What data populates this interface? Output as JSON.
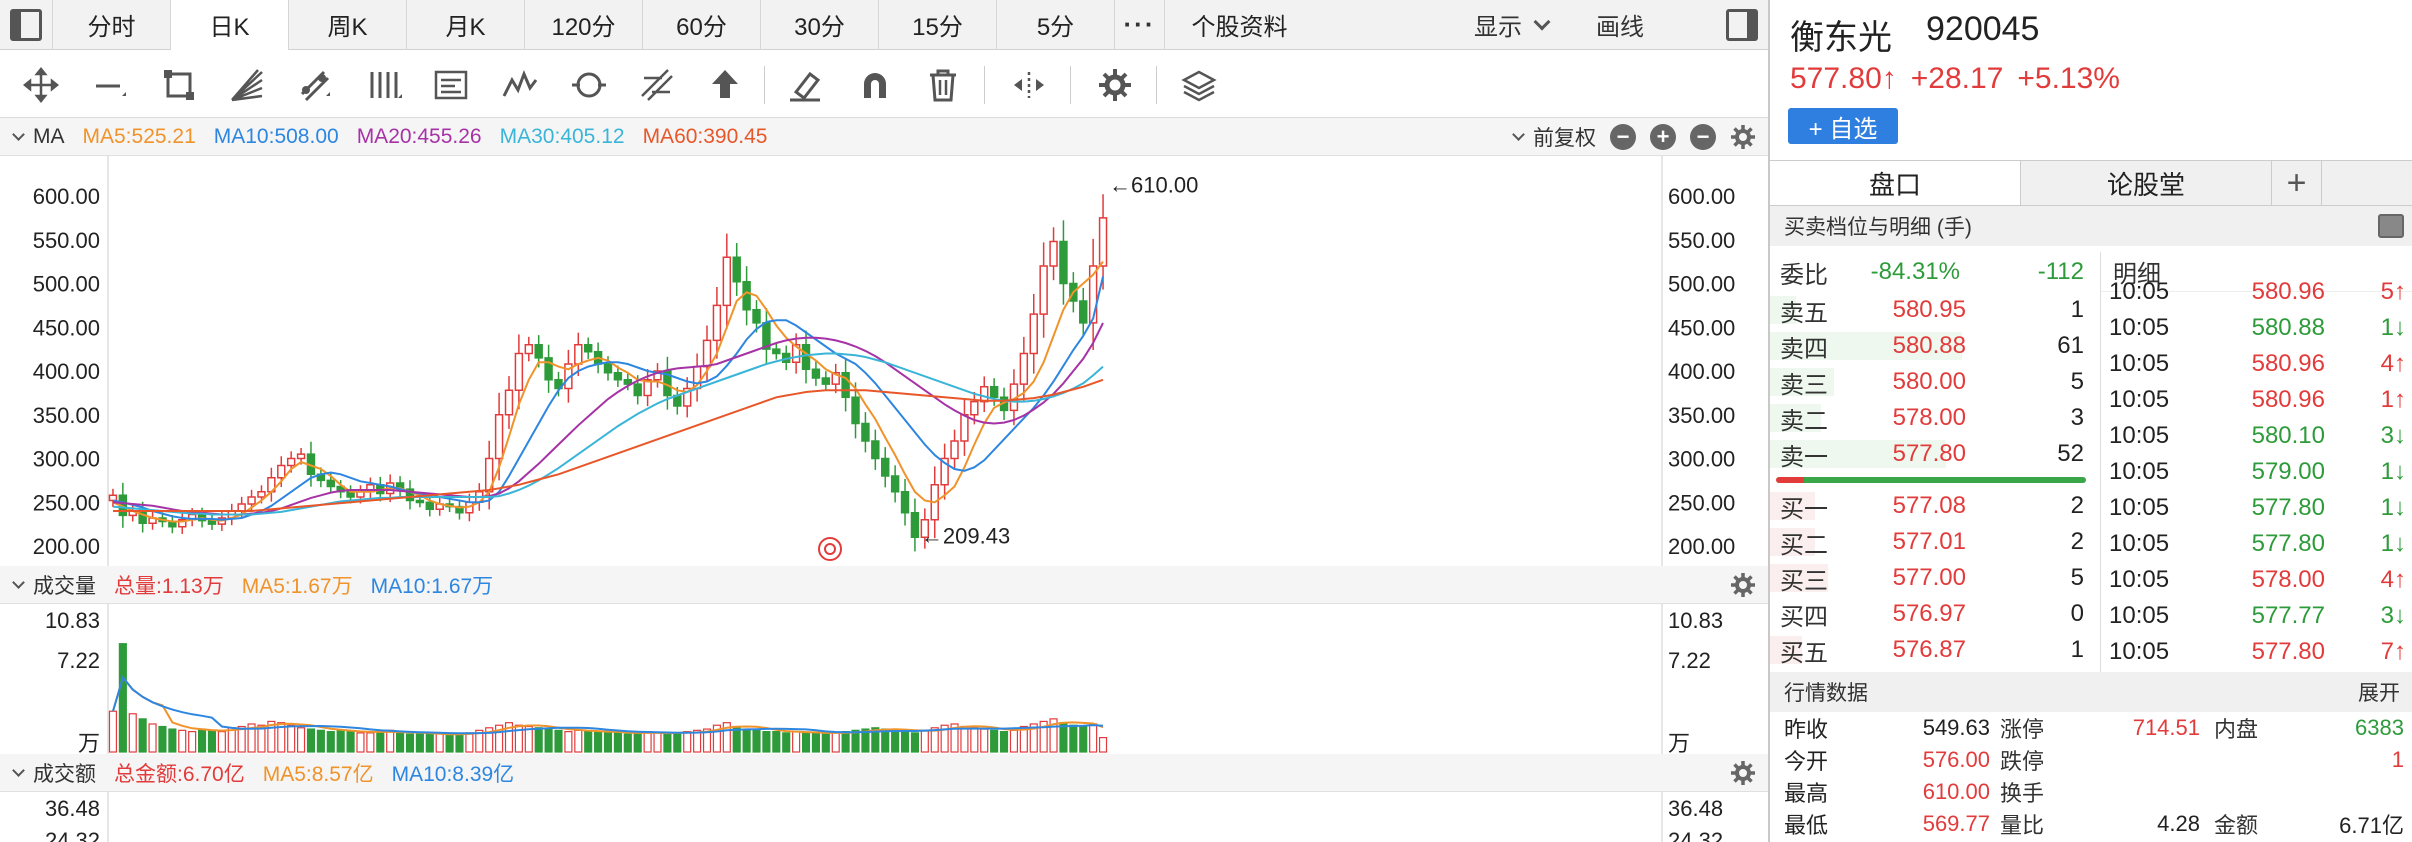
{
  "period_tabs": [
    {
      "label": "分时",
      "active": false
    },
    {
      "label": "日K",
      "active": true
    },
    {
      "label": "周K",
      "active": false
    },
    {
      "label": "月K",
      "active": false
    },
    {
      "label": "120分",
      "active": false
    },
    {
      "label": "60分",
      "active": false
    },
    {
      "label": "30分",
      "active": false
    },
    {
      "label": "15分",
      "active": false
    },
    {
      "label": "5分",
      "active": false
    }
  ],
  "more_label": "···",
  "stock_info_tab": "个股资料",
  "display_label": "显示",
  "draw_label": "画线",
  "toolbar_icons": [
    "crosshair-icon",
    "line-icon",
    "crop-icon",
    "fan-icon",
    "channel-icon",
    "vertical-lines-icon",
    "text-label-icon",
    "wave-icon",
    "cycle-icon",
    "fibonacci-icon",
    "arrow-up-icon",
    "eraser-icon",
    "magnet-icon",
    "trash-icon",
    "expand-icon",
    "settings-icon",
    "layers-icon"
  ],
  "ma_bar": {
    "label": "MA",
    "items": [
      {
        "text": "MA5:525.21",
        "color": "#f0932b"
      },
      {
        "text": "MA10:508.00",
        "color": "#2d86e0"
      },
      {
        "text": "MA20:455.26",
        "color": "#a633a6"
      },
      {
        "text": "MA30:405.12",
        "color": "#3ab5d8"
      },
      {
        "text": "MA60:390.45",
        "color": "#e8572a"
      }
    ],
    "adjust_label": "前复权"
  },
  "price_axis": {
    "ticks": [
      "600.00",
      "550.00",
      "500.00",
      "450.00",
      "400.00",
      "350.00",
      "300.00",
      "250.00",
      "200.00"
    ],
    "min": 200,
    "max": 600
  },
  "annotations": {
    "high": "←610.00",
    "low": "←209.43"
  },
  "volume_bar": {
    "label": "成交量",
    "items": [
      {
        "text": "总量:1.13万",
        "color": "#e23b3b"
      },
      {
        "text": "MA5:1.67万",
        "color": "#f0932b"
      },
      {
        "text": "MA10:1.67万",
        "color": "#2d86e0"
      }
    ],
    "ticks": [
      "10.83",
      "7.22",
      "万"
    ]
  },
  "amount_bar": {
    "label": "成交额",
    "items": [
      {
        "text": "总金额:6.70亿",
        "color": "#e23b3b"
      },
      {
        "text": "MA5:8.57亿",
        "color": "#f0932b"
      },
      {
        "text": "MA10:8.39亿",
        "color": "#2d86e0"
      }
    ],
    "ticks": [
      "36.48",
      "24.32"
    ]
  },
  "chart_data": {
    "type": "candlestick",
    "ylim": [
      200,
      600
    ],
    "close": [
      258,
      235,
      240,
      226,
      232,
      228,
      222,
      230,
      236,
      229,
      225,
      232,
      240,
      248,
      256,
      262,
      278,
      292,
      300,
      305,
      282,
      275,
      268,
      262,
      256,
      262,
      270,
      260,
      272,
      265,
      252,
      250,
      242,
      248,
      245,
      238,
      250,
      262,
      300,
      350,
      378,
      420,
      430,
      415,
      390,
      380,
      408,
      430,
      422,
      408,
      398,
      390,
      385,
      372,
      390,
      400,
      372,
      360,
      380,
      405,
      435,
      475,
      530,
      502,
      470,
      455,
      425,
      420,
      410,
      430,
      402,
      392,
      385,
      398,
      370,
      340,
      320,
      300,
      280,
      262,
      238,
      210,
      230,
      270,
      300,
      320,
      350,
      365,
      382,
      370,
      355,
      385,
      420,
      465,
      520,
      548,
      500,
      480,
      455,
      520,
      575
    ],
    "ma5": [
      250,
      245,
      240,
      236,
      232,
      230,
      228,
      228,
      230,
      232,
      230,
      229,
      232,
      236,
      244,
      252,
      262,
      274,
      288,
      296,
      292,
      288,
      280,
      270,
      262,
      262,
      262,
      264,
      266,
      266,
      262,
      258,
      252,
      248,
      246,
      244,
      245,
      250,
      262,
      290,
      325,
      362,
      390,
      410,
      410,
      405,
      402,
      408,
      412,
      415,
      412,
      404,
      398,
      390,
      388,
      388,
      384,
      378,
      376,
      384,
      400,
      420,
      450,
      480,
      490,
      486,
      470,
      452,
      438,
      428,
      420,
      412,
      402,
      396,
      392,
      380,
      362,
      345,
      324,
      304,
      282,
      262,
      252,
      250,
      258,
      268,
      290,
      316,
      340,
      358,
      364,
      368,
      375,
      388,
      410,
      440,
      470,
      490,
      500,
      510,
      525
    ],
    "ma10": [
      252,
      250,
      247,
      244,
      240,
      237,
      234,
      232,
      231,
      231,
      231,
      230,
      231,
      232,
      236,
      240,
      246,
      254,
      262,
      270,
      278,
      282,
      284,
      282,
      278,
      274,
      272,
      270,
      268,
      265,
      262,
      260,
      258,
      256,
      254,
      252,
      250,
      250,
      252,
      262,
      280,
      300,
      320,
      340,
      360,
      378,
      392,
      400,
      405,
      408,
      410,
      410,
      408,
      404,
      400,
      398,
      396,
      392,
      388,
      386,
      388,
      394,
      406,
      420,
      436,
      448,
      456,
      458,
      458,
      452,
      444,
      436,
      428,
      420,
      414,
      408,
      398,
      386,
      372,
      358,
      344,
      330,
      316,
      304,
      295,
      288,
      286,
      290,
      298,
      310,
      322,
      334,
      346,
      358,
      372,
      388,
      406,
      424,
      440,
      460,
      508
    ],
    "ma20": [
      250,
      249,
      248,
      247,
      246,
      244,
      242,
      240,
      239,
      238,
      237,
      236,
      236,
      236,
      237,
      238,
      240,
      243,
      247,
      251,
      255,
      258,
      261,
      263,
      264,
      264,
      264,
      264,
      264,
      263,
      262,
      261,
      260,
      259,
      258,
      257,
      256,
      256,
      257,
      260,
      266,
      274,
      284,
      294,
      305,
      316,
      327,
      338,
      348,
      358,
      368,
      376,
      383,
      389,
      394,
      398,
      401,
      403,
      404,
      405,
      406,
      408,
      412,
      416,
      420,
      424,
      428,
      432,
      435,
      437,
      438,
      438,
      437,
      435,
      432,
      428,
      423,
      417,
      410,
      402,
      394,
      386,
      378,
      370,
      362,
      355,
      349,
      344,
      341,
      340,
      341,
      344,
      349,
      356,
      364,
      374,
      386,
      400,
      414,
      432,
      455
    ],
    "ma30": [
      245,
      244,
      243,
      242,
      241,
      240,
      239,
      238,
      237,
      237,
      236,
      236,
      236,
      236,
      236,
      237,
      238,
      239,
      241,
      243,
      245,
      247,
      249,
      251,
      252,
      253,
      254,
      255,
      255,
      256,
      256,
      256,
      256,
      256,
      256,
      256,
      256,
      256,
      256,
      257,
      260,
      264,
      269,
      275,
      282,
      289,
      297,
      305,
      313,
      321,
      329,
      337,
      344,
      351,
      357,
      363,
      368,
      372,
      376,
      380,
      384,
      388,
      392,
      396,
      400,
      404,
      408,
      411,
      414,
      416,
      418,
      419,
      420,
      420,
      419,
      418,
      416,
      413,
      410,
      406,
      402,
      398,
      394,
      390,
      386,
      382,
      378,
      374,
      371,
      368,
      366,
      365,
      365,
      366,
      368,
      371,
      375,
      380,
      386,
      395,
      405
    ],
    "ma60": [
      240,
      240,
      240,
      240,
      240,
      240,
      240,
      240,
      240,
      240,
      240,
      240,
      240,
      240,
      240,
      241,
      242,
      243,
      244,
      245,
      246,
      247,
      248,
      249,
      250,
      251,
      252,
      253,
      254,
      255,
      256,
      257,
      258,
      259,
      260,
      261,
      262,
      263,
      264,
      266,
      268,
      270,
      273,
      276,
      279,
      282,
      286,
      290,
      294,
      298,
      302,
      306,
      310,
      314,
      318,
      322,
      326,
      330,
      334,
      338,
      342,
      346,
      350,
      354,
      358,
      362,
      366,
      370,
      372,
      374,
      376,
      377,
      378,
      378,
      378,
      378,
      378,
      377,
      376,
      375,
      374,
      373,
      372,
      371,
      370,
      369,
      368,
      367,
      366,
      366,
      366,
      367,
      368,
      369,
      371,
      373,
      376,
      379,
      382,
      386,
      390
    ],
    "volume_max": 10.83,
    "volume": [
      3.2,
      8.5,
      3.0,
      2.6,
      2.2,
      2.0,
      1.8,
      1.7,
      1.6,
      1.8,
      1.7,
      1.6,
      1.9,
      2.0,
      2.2,
      2.1,
      2.4,
      2.3,
      2.1,
      1.9,
      1.8,
      1.7,
      1.6,
      1.7,
      1.6,
      1.5,
      1.5,
      1.6,
      1.7,
      1.5,
      1.4,
      1.4,
      1.4,
      1.5,
      1.3,
      1.4,
      1.5,
      1.7,
      1.9,
      2.1,
      2.3,
      2.1,
      2.0,
      1.9,
      1.8,
      1.7,
      1.6,
      1.7,
      1.6,
      1.6,
      1.5,
      1.5,
      1.4,
      1.5,
      1.6,
      1.5,
      1.4,
      1.5,
      1.6,
      1.7,
      1.8,
      2.1,
      2.3,
      2.0,
      1.8,
      1.7,
      1.6,
      1.6,
      1.5,
      1.6,
      1.5,
      1.5,
      1.4,
      1.5,
      1.6,
      1.7,
      1.8,
      1.9,
      1.8,
      1.7,
      1.6,
      1.5,
      1.7,
      1.9,
      2.1,
      2.2,
      2.0,
      1.9,
      1.8,
      1.7,
      1.6,
      1.7,
      2.0,
      2.2,
      2.4,
      2.6,
      2.3,
      2.1,
      2.0,
      2.2,
      1.13
    ]
  },
  "right": {
    "name": "衡东光",
    "code": "920045",
    "price": "577.80↑",
    "change": "+28.17",
    "pct": "+5.13%",
    "fav": "+ 自选",
    "tabs": [
      "盘口",
      "论股堂",
      "+"
    ],
    "book_title": "买卖档位与明细 (手)",
    "weibi_label": "委比",
    "weibi_pct": "-84.31%",
    "weibi_val": "-112",
    "sells": [
      {
        "label": "卖五",
        "price": "580.95",
        "vol": "1",
        "w": 8
      },
      {
        "label": "卖四",
        "price": "580.88",
        "vol": "61",
        "w": 60
      },
      {
        "label": "卖三",
        "price": "580.00",
        "vol": "5",
        "w": 20
      },
      {
        "label": "卖二",
        "price": "578.00",
        "vol": "3",
        "w": 16
      },
      {
        "label": "卖一",
        "price": "577.80",
        "vol": "52",
        "w": 55
      }
    ],
    "buys": [
      {
        "label": "买一",
        "price": "577.08",
        "vol": "2",
        "w": 14
      },
      {
        "label": "买二",
        "price": "577.01",
        "vol": "2",
        "w": 14
      },
      {
        "label": "买三",
        "price": "577.00",
        "vol": "5",
        "w": 18
      },
      {
        "label": "买四",
        "price": "576.97",
        "vol": "0",
        "w": 0
      },
      {
        "label": "买五",
        "price": "576.87",
        "vol": "1",
        "w": 10
      }
    ],
    "detail_title": "明细",
    "details": [
      {
        "t": "10:05",
        "p": "580.96",
        "v": "5↑",
        "c": "red"
      },
      {
        "t": "10:05",
        "p": "580.88",
        "v": "1↓",
        "c": "green"
      },
      {
        "t": "10:05",
        "p": "580.96",
        "v": "4↑",
        "c": "red"
      },
      {
        "t": "10:05",
        "p": "580.96",
        "v": "1↑",
        "c": "red"
      },
      {
        "t": "10:05",
        "p": "580.10",
        "v": "3↓",
        "c": "green"
      },
      {
        "t": "10:05",
        "p": "579.00",
        "v": "1↓",
        "c": "green"
      },
      {
        "t": "10:05",
        "p": "577.80",
        "v": "1↓",
        "c": "green"
      },
      {
        "t": "10:05",
        "p": "577.80",
        "v": "1↓",
        "c": "green"
      },
      {
        "t": "10:05",
        "p": "578.00",
        "v": "4↑",
        "c": "red"
      },
      {
        "t": "10:05",
        "p": "577.77",
        "v": "3↓",
        "c": "green"
      },
      {
        "t": "10:05",
        "p": "577.80",
        "v": "7↑",
        "c": "red"
      }
    ],
    "quote_title": "行情数据",
    "expand": "展开",
    "quote_rows": [
      {
        "k": "昨收",
        "v": "549.63",
        "vc": "blk",
        "k2": "涨停",
        "v2": "714.51",
        "v2c": "red",
        "k3": "内盘",
        "v3": "6383",
        "v3c": "green"
      },
      {
        "k": "今开",
        "v": "576.00",
        "vc": "red",
        "k2": "跌停",
        "v2": "",
        "v2c": "green",
        "k3": "",
        "v3": "1",
        "v3c": "red"
      },
      {
        "k": "最高",
        "v": "610.00",
        "vc": "red",
        "k2": "换手",
        "v2": "",
        "v2c": "blk",
        "k3": "",
        "v3": "",
        "v3c": "blk"
      },
      {
        "k": "最低",
        "v": "569.77",
        "vc": "red",
        "k2": "量比",
        "v2": "4.28",
        "v2c": "blk",
        "k3": "金额",
        "v3": "6.71亿",
        "v3c": "blk"
      }
    ]
  }
}
